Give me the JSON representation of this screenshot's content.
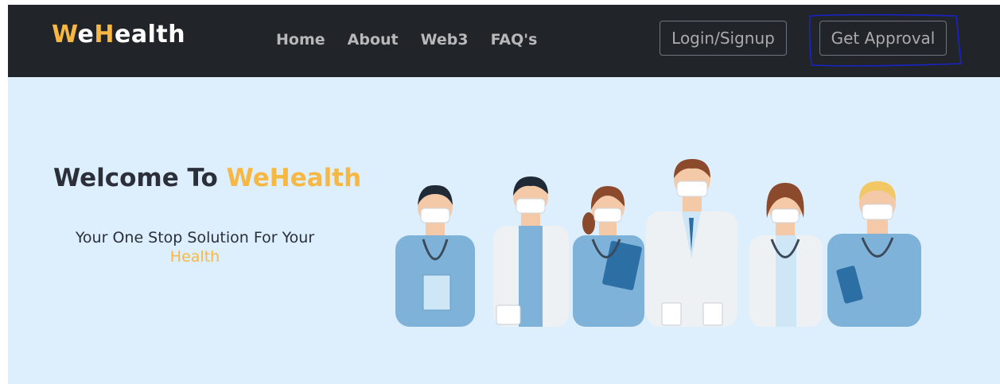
{
  "navbar": {
    "brand": {
      "part1": "W",
      "part2": "e",
      "part3": "H",
      "part4": "ealth"
    },
    "links": [
      "Home",
      "About",
      "Web3",
      "FAQ's"
    ],
    "login_label": "Login/Signup",
    "approval_label": "Get Approval"
  },
  "hero": {
    "title_prefix": "Welcome To ",
    "title_accent": "WeHealth",
    "subtitle": "Your One Stop Solution For Your",
    "subtitle_accent": "Health"
  },
  "colors": {
    "navbar_bg": "#212529",
    "accent": "#f6b843",
    "hero_bg": "#ddeefd",
    "annotation_ink": "#1a23c8"
  },
  "icons": {
    "illustration": "medical-staff-illustration"
  }
}
